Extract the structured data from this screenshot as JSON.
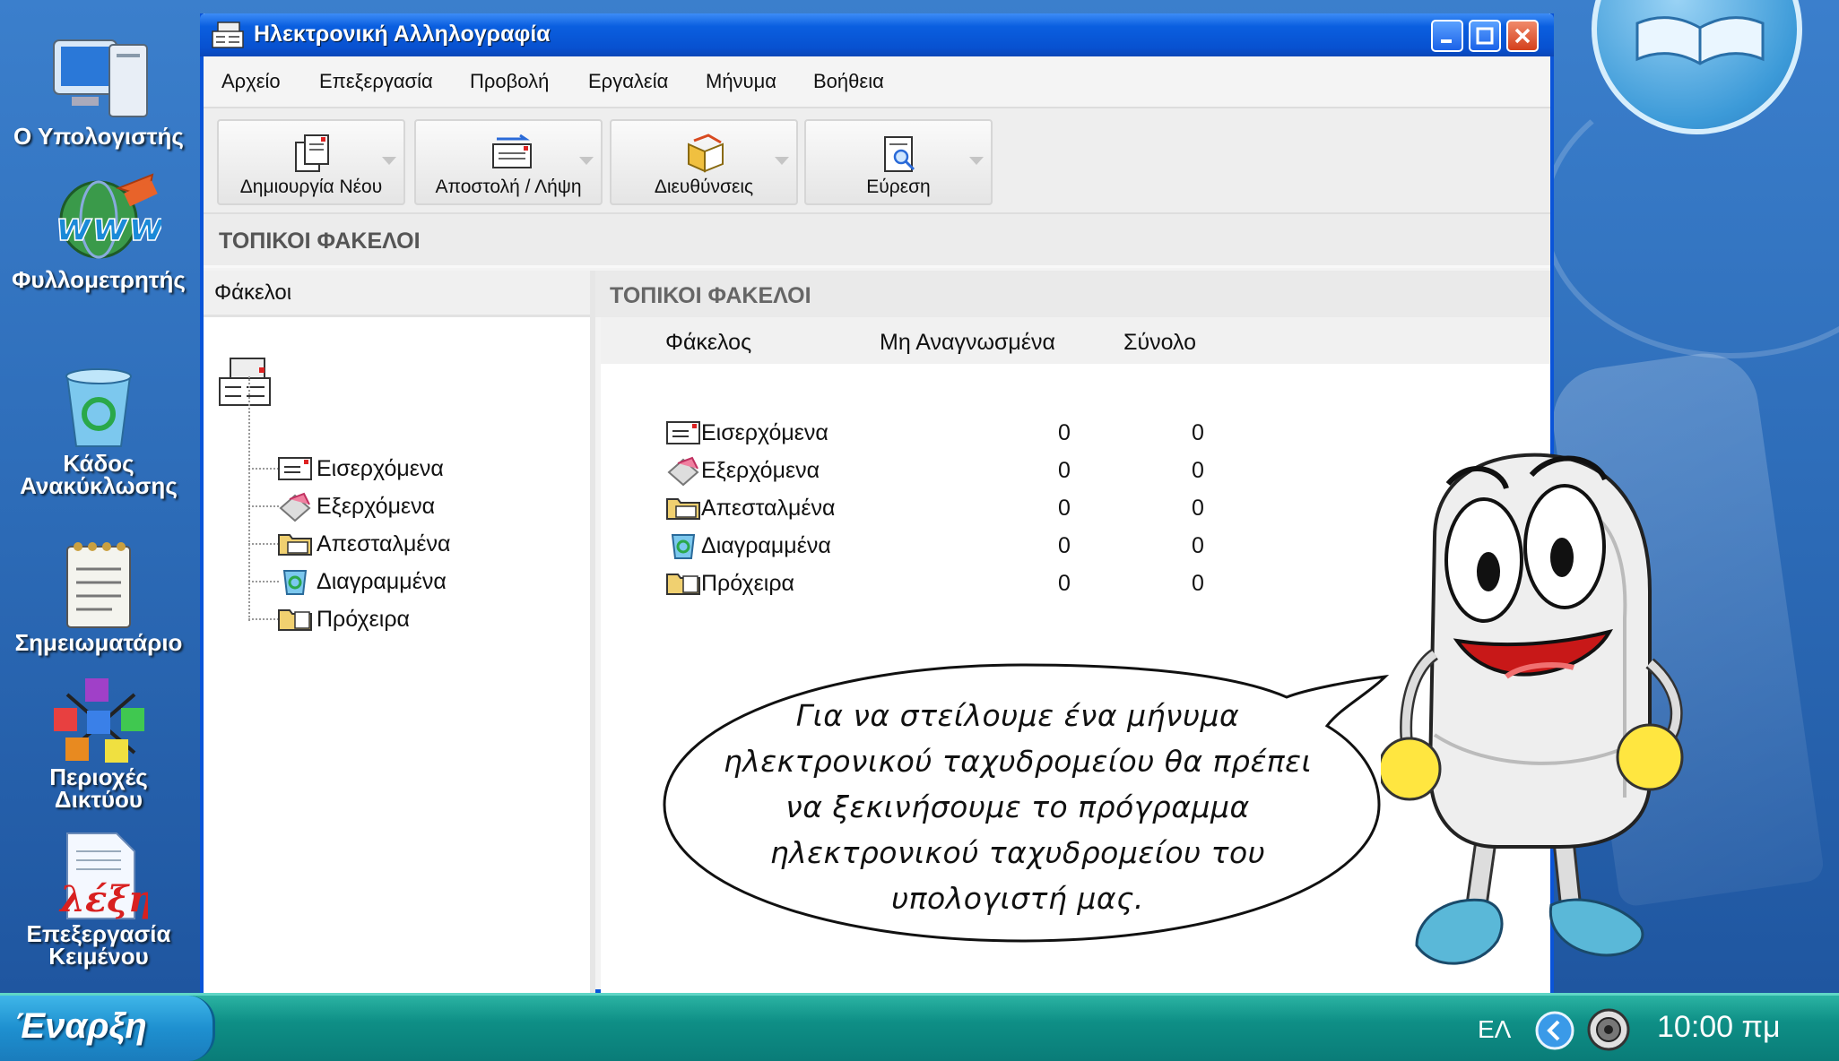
{
  "desktop": {
    "icons": [
      {
        "label_lines": [
          "Ο Υπολογιστής"
        ]
      },
      {
        "label_lines": [
          "Φυλλομετρητής"
        ]
      },
      {
        "label_lines": [
          "Κάδος",
          "Ανακύκλωσης"
        ]
      },
      {
        "label_lines": [
          "Σημειωματάριο"
        ]
      },
      {
        "label_lines": [
          "Περιοχές",
          "Δικτύου"
        ]
      },
      {
        "label_lines": [
          "Επεξεργασία",
          "Κειμένου"
        ]
      }
    ],
    "word_icon_text": "λέξη"
  },
  "window": {
    "title": "Ηλεκτρονική Αλληλογραφία",
    "menu": [
      "Αρχείο",
      "Επεξεργασία",
      "Προβολή",
      "Εργαλεία",
      "Μήνυμα",
      "Βοήθεια"
    ],
    "toolbar": [
      {
        "label": "Δημιουργία Νέου",
        "icon": "new-mail-icon"
      },
      {
        "label": "Αποστολή / Λήψη",
        "icon": "send-receive-icon"
      },
      {
        "label": "Διευθύνσεις",
        "icon": "address-book-icon"
      },
      {
        "label": "Εύρεση",
        "icon": "find-icon"
      }
    ],
    "location": "ΤΟΠΙΚΟΙ ΦΑΚΕΛΟΙ",
    "folder_pane": {
      "header": "Φάκελοι",
      "items": [
        "Εισερχόμενα",
        "Εξερχόμενα",
        "Απεσταλμένα",
        "Διαγραμμένα",
        "Πρόχειρα"
      ]
    },
    "content_pane": {
      "header": "ΤΟΠΙΚΟΙ ΦΑΚΕΛΟΙ",
      "columns": [
        "Φάκελος",
        "Μη Αναγνωσμένα",
        "Σύνολο"
      ],
      "rows": [
        {
          "name": "Εισερχόμενα",
          "unread": "0",
          "total": "0"
        },
        {
          "name": "Εξερχόμενα",
          "unread": "0",
          "total": "0"
        },
        {
          "name": "Απεσταλμένα",
          "unread": "0",
          "total": "0"
        },
        {
          "name": "Διαγραμμένα",
          "unread": "0",
          "total": "0"
        },
        {
          "name": "Πρόχειρα",
          "unread": "0",
          "total": "0"
        }
      ]
    }
  },
  "bubble": {
    "lines": [
      "Για να στείλουμε ένα μήνυμα",
      "ηλεκτρονικού ταχυδρομείου θα πρέπει",
      "να ξεκινήσουμε το πρόγραμμα",
      "ηλεκτρονικού ταχυδρομείου του",
      "υπολογιστή μας."
    ]
  },
  "taskbar": {
    "start_label": "Έναρξη",
    "language": "ΕΛ",
    "clock": "10:00 πμ"
  },
  "colors": {
    "title_bar": "#0a5fe0",
    "taskbar": "#0e8f86",
    "start_button": "#1e90d0",
    "desktop": "#2d6cb8"
  }
}
